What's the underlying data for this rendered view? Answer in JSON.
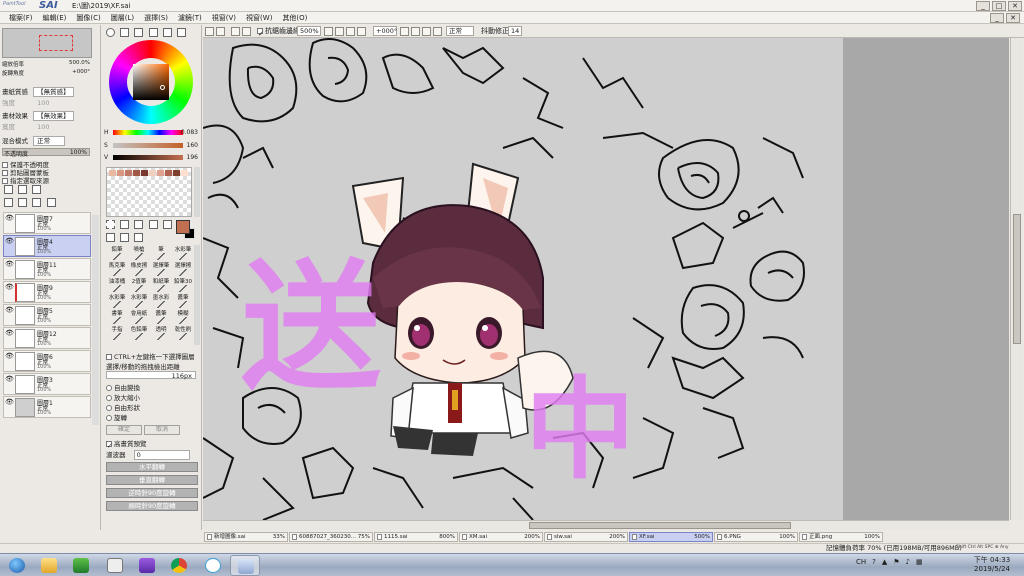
{
  "app": {
    "logo_small": "PaintTool",
    "logo_big": "SAI",
    "doc_path": "E:\\圖\\2019\\XF.sai",
    "win_min": "_",
    "win_max": "□",
    "win_close": "✕"
  },
  "menu": [
    "檔案(F)",
    "編輯(E)",
    "圖像(C)",
    "圖層(L)",
    "選擇(S)",
    "濾鏡(T)",
    "視窗(V)",
    "視窗(W)",
    "其他(O)"
  ],
  "navigator": {
    "zoom_label": "縮放倍率",
    "zoom_value": "500.0%",
    "angle_label": "旋轉角度",
    "angle_value": "+000°"
  },
  "layer_props": {
    "paper_texture_label": "畫紙質感",
    "paper_texture_value": "【無質感】",
    "intensity_label": "強度",
    "intensity_value": "100",
    "paper_effect_label": "畫材效果",
    "paper_effect_value": "【無效果】",
    "width_label": "寬度",
    "width_value": "100",
    "blend_label": "混合模式",
    "blend_value": "正常",
    "opacity_label": "不透明度",
    "opacity_value": "100%",
    "protect_label": "保護不透明度",
    "clip_label": "剪貼圖層蒙板",
    "source_label": "指定選取來源"
  },
  "layers": [
    {
      "name": "圖層7",
      "mode": "正常",
      "opacity": "100%",
      "selected": false
    },
    {
      "name": "圖層4",
      "mode": "正常",
      "opacity": "100%",
      "selected": true
    },
    {
      "name": "圖層11",
      "mode": "正常",
      "opacity": "100%",
      "selected": false
    },
    {
      "name": "圖層9",
      "mode": "正常",
      "opacity": "100%",
      "selected": false
    },
    {
      "name": "圖層5",
      "mode": "正常",
      "opacity": "100%",
      "selected": false
    },
    {
      "name": "圖層12",
      "mode": "正常",
      "opacity": "100%",
      "selected": false
    },
    {
      "name": "圖層6",
      "mode": "正常",
      "opacity": "100%",
      "selected": false
    },
    {
      "name": "圖層3",
      "mode": "正常",
      "opacity": "100%",
      "selected": false
    },
    {
      "name": "圖層1",
      "mode": "正常",
      "opacity": "100%",
      "selected": false
    }
  ],
  "color": {
    "h_label": "H",
    "h_value": "0.083",
    "s_label": "S",
    "s_value": "160",
    "v_label": "V",
    "v_value": "196",
    "foreground": "#c07050",
    "background": "#000000",
    "swatches": [
      "#e8b8a0",
      "#d89880",
      "#c07868",
      "#a05848",
      "#7a3a30",
      "#f0d0c0",
      "#e0a090",
      "#b06050",
      "#804030",
      "#ffe0d0"
    ]
  },
  "brushes": [
    [
      "鉛筆",
      "噴槍",
      "筆",
      "水彩筆"
    ],
    [
      "馬克筆",
      "橡皮擦",
      "選擇筆",
      "選擇擦"
    ],
    [
      "油漆桶",
      "2值筆",
      "和紙筆",
      "鉛筆30"
    ],
    [
      "水彩筆",
      "水彩筆",
      "墨水彩",
      "醬筆"
    ],
    [
      "書筆",
      "會用紙",
      "醬筆",
      "模糊"
    ],
    [
      "手指",
      "色鉛筆",
      "透明",
      "乾性刷"
    ]
  ],
  "transform": {
    "ctrl_label": "CTRL+左鍵拖一下選擇圖層",
    "drag_label": "選擇/移動的拖拽檢出距離",
    "drag_value": "116px",
    "free_transform": "自由變換",
    "scale": "放大縮小",
    "free_shape": "自由形狀",
    "rotate": "旋轉",
    "confirm": "確定",
    "cancel": "取消",
    "quality_preview": "高畫質預覽",
    "blur_label": "濾波器",
    "blur_value": "0",
    "flip_h": "水平翻轉",
    "flip_v": "垂直翻轉",
    "rot_ccw": "逆時針90度旋轉",
    "rot_cw": "順時針90度旋轉"
  },
  "canvas_toolbar": {
    "antialias_label": "抗鋸齒邊緣",
    "zoom_value": "500%",
    "angle_value": "+000°",
    "mode_value": "正常",
    "stabilizer_label": "抖動修正",
    "stabilizer_value": "14"
  },
  "doc_tabs": [
    {
      "name": "新增圖像.sai",
      "zoom": "33%",
      "selected": false
    },
    {
      "name": "60887027_360230...",
      "zoom": "75%",
      "selected": false
    },
    {
      "name": "1115.sai",
      "zoom": "800%",
      "selected": false
    },
    {
      "name": "XM.sai",
      "zoom": "200%",
      "selected": false
    },
    {
      "name": "slw.sai",
      "zoom": "200%",
      "selected": false
    },
    {
      "name": "XF.sai",
      "zoom": "500%",
      "selected": true
    },
    {
      "name": "6.PNG",
      "zoom": "100%",
      "selected": false
    },
    {
      "name": "正面.png",
      "zoom": "100%",
      "selected": false
    }
  ],
  "status": {
    "memory": "記憶體負荷率 70%  (已用198MB/可用896MB)",
    "indicators": "Shift Ctrl Alt SPC ⊗ Any"
  },
  "canvas_text": {
    "char1": "送",
    "char2": "中"
  },
  "taskbar": {
    "ime": "CH",
    "time": "下午 04:33",
    "date": "2019/5/24"
  }
}
